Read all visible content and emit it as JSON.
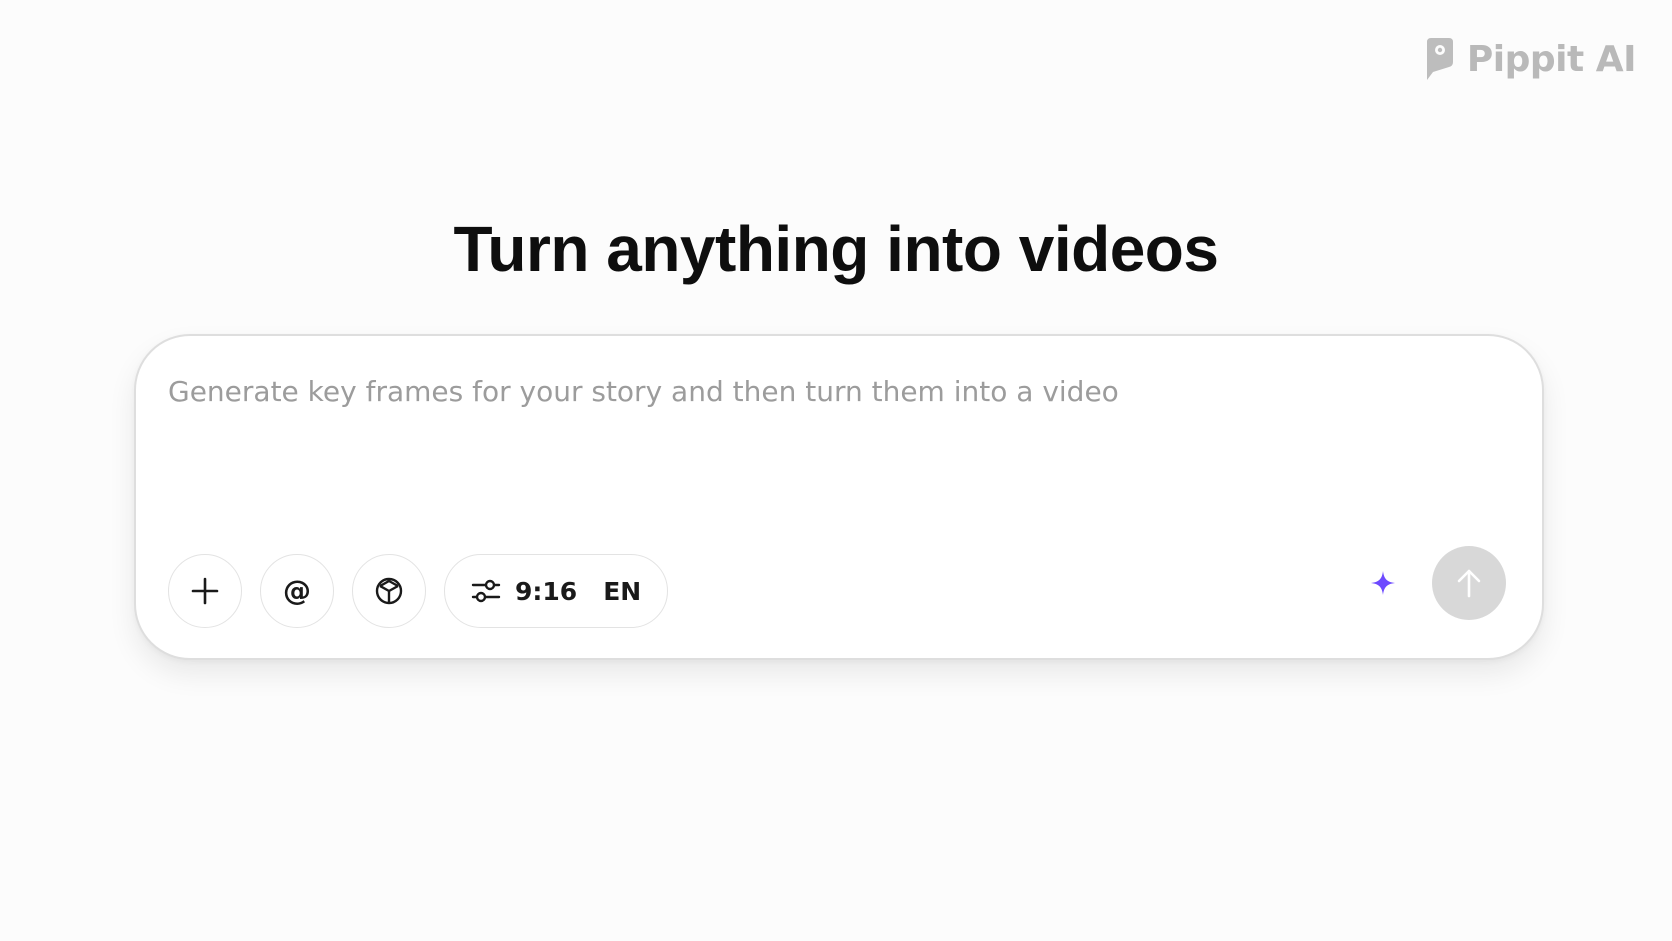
{
  "brand": {
    "name": "Pippit AI",
    "icon": "pippit-logo-icon"
  },
  "hero": {
    "title": "Turn anything into videos"
  },
  "composer": {
    "input_value": "",
    "placeholder": "Generate key frames for your story and then turn them into a video",
    "toolbar": {
      "add_icon": "plus-icon",
      "mention_icon": "at-icon",
      "mention_glyph": "@",
      "model_icon": "cube-icon",
      "settings_icon": "sliders-icon",
      "aspect_ratio": "9:16",
      "language": "EN"
    },
    "actions": {
      "enhance_icon": "sparkle-icon",
      "send_icon": "arrow-up-icon"
    }
  },
  "colors": {
    "background": "#fcfcfc",
    "accent": "#6d4aff",
    "send_disabled": "#d8d8d8",
    "brand_gray": "#b9b9b9"
  }
}
